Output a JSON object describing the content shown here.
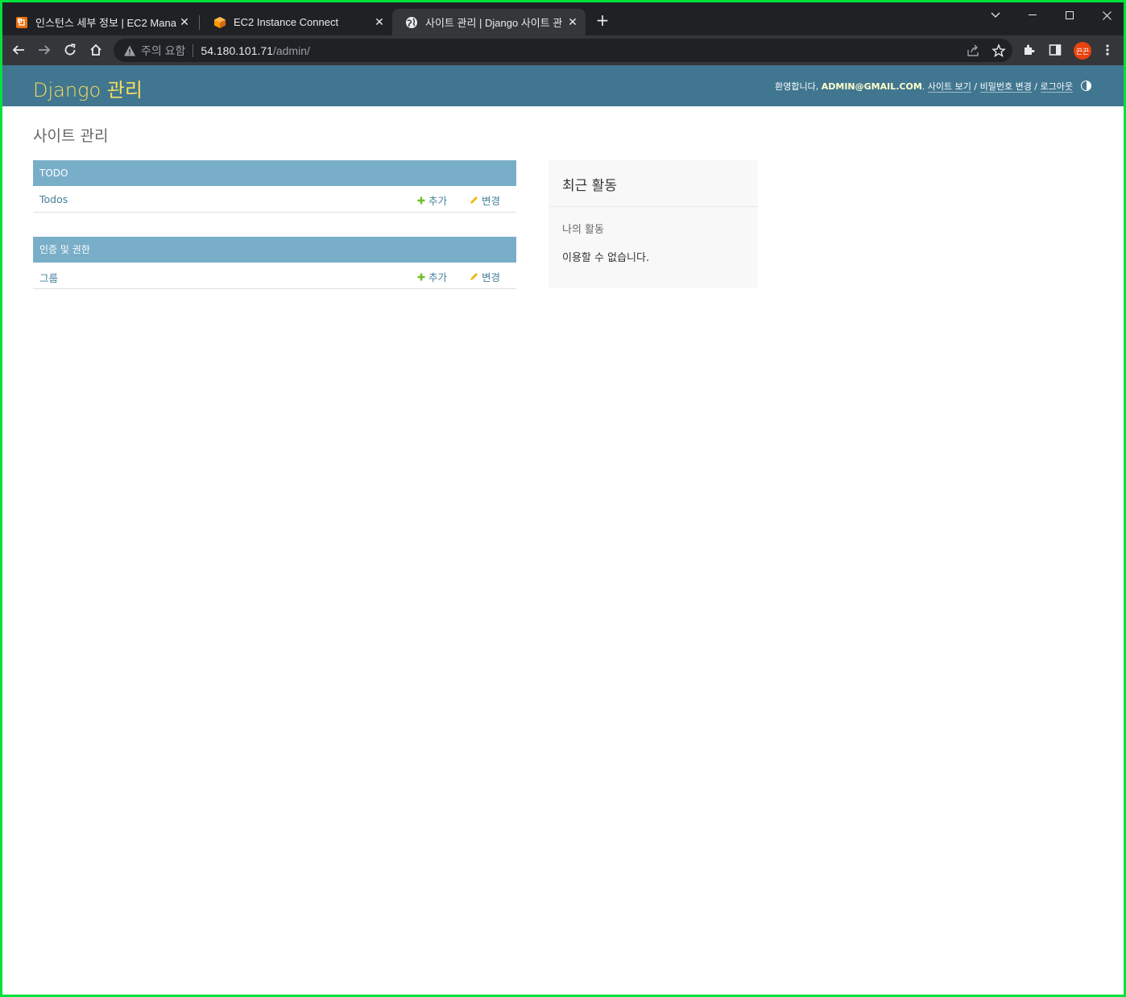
{
  "browser": {
    "tabs": [
      {
        "title": "인스턴스 세부 정보 | EC2 Manag",
        "icon": "aws-ec2-icon",
        "active": false
      },
      {
        "title": "EC2 Instance Connect",
        "icon": "aws-cube-icon",
        "active": false
      },
      {
        "title": "사이트 관리 | Django 사이트 관",
        "icon": "globe-icon",
        "active": true
      }
    ],
    "close_glyph": "✕",
    "new_tab_glyph": "+",
    "omnibox": {
      "warning_text": "주의 요함",
      "host": "54.180.101.71",
      "path": "/admin/"
    },
    "profile_initials": "끈끈",
    "colors": {
      "frame": "#202124",
      "toolbar": "#35363a",
      "accent_border": "#00e23c"
    }
  },
  "header": {
    "brand": "Django 관리",
    "welcome": "환영합니다, ",
    "user": "ADMIN@GMAIL.COM",
    "period": ". ",
    "view_site": "사이트 보기",
    "slash": " / ",
    "change_password": "비밀번호 변경",
    "logout": "로그아웃",
    "colors": {
      "header_bg": "#417690",
      "brand": "#f5dd5d"
    }
  },
  "content": {
    "title": "사이트 관리",
    "modules": [
      {
        "caption": "TODO",
        "rows": [
          {
            "model": "Todos",
            "add": "추가",
            "change": "변경"
          }
        ]
      },
      {
        "caption": "인증 및 권한",
        "rows": [
          {
            "model": "그룹",
            "add": "추가",
            "change": "변경"
          }
        ]
      }
    ],
    "recent_actions": {
      "title": "최근 활동",
      "subtitle": "나의 활동",
      "empty": "이용할 수 없습니다."
    },
    "colors": {
      "caption_bg": "#79aec8",
      "link": "#447e9b",
      "add_icon": "#70bf2b",
      "change_icon": "#efb80b"
    }
  }
}
